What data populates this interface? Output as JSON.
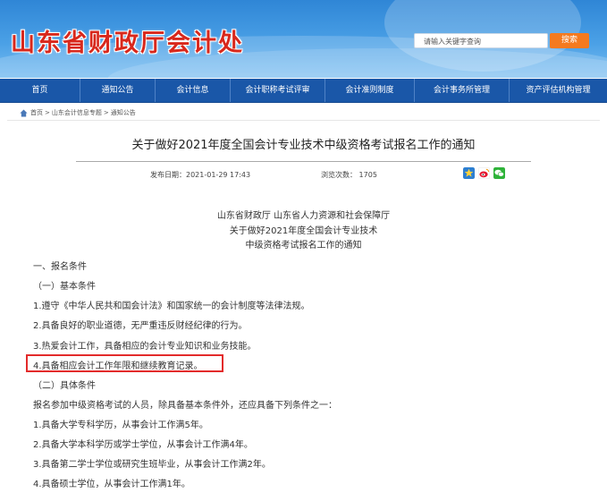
{
  "header": {
    "site_title": "山东省财政厅会计处",
    "search_placeholder": "请输入关键字查询",
    "search_button": "搜索"
  },
  "nav": {
    "items": [
      {
        "label": "首页"
      },
      {
        "label": "通知公告"
      },
      {
        "label": "会计信息"
      },
      {
        "label": "会计职称考试评审"
      },
      {
        "label": "会计准则制度"
      },
      {
        "label": "会计事务所管理"
      },
      {
        "label": "资产评估机构管理"
      }
    ]
  },
  "breadcrumb": {
    "home": "首页",
    "sep1": ">",
    "section": "山东会计信息专题",
    "sep2": ">",
    "current": "通知公告"
  },
  "article": {
    "title": "关于做好2021年度全国会计专业技术中级资格考试报名工作的通知",
    "publish_label": "发布日期：",
    "publish_date": "2021-01-29 17:43",
    "views_label": "浏览次数：",
    "views": "1705",
    "share_icons": [
      "star-share-icon",
      "weibo-icon",
      "wechat-icon"
    ],
    "issuers": "山东省财政厅    山东省人力资源和社会保障厅",
    "doc_title_1": "关于做好2021年度全国会计专业技术",
    "doc_title_2": "中级资格考试报名工作的通知",
    "lines": [
      "一、报名条件",
      "（一）基本条件",
      "1.遵守《中华人民共和国会计法》和国家统一的会计制度等法律法规。",
      "2.具备良好的职业道德，无严重违反财经纪律的行为。",
      "3.热爱会计工作，具备相应的会计专业知识和业务技能。",
      "4.具备相应会计工作年限和继续教育记录。",
      "（二）具体条件",
      "报名参加中级资格考试的人员，除具备基本条件外，还应具备下列条件之一：",
      "1.具备大学专科学历，从事会计工作满5年。",
      "2.具备大学本科学历或学士学位，从事会计工作满4年。",
      "3.具备第二学士学位或研究生班毕业，从事会计工作满2年。",
      "4.具备硕士学位，从事会计工作满1年。"
    ]
  },
  "colors": {
    "nav_bg": "#1a57a8",
    "search_button": "#f47a1f",
    "highlight_border": "#e32b2b",
    "title_red": "#d8281c"
  }
}
